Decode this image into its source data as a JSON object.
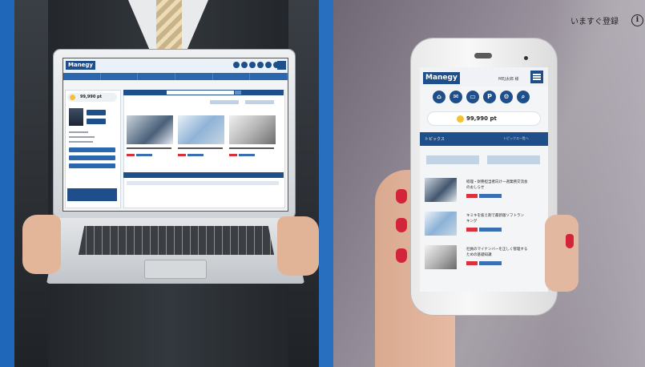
{
  "overlay": {
    "register_label": "いますぐ登録",
    "info_icon": "i"
  },
  "laptop_app": {
    "logo": "Manegy",
    "points": "99,990 pt"
  },
  "phone_app": {
    "logo": "Manegy",
    "user": "MEJ太郎 様",
    "points": "99,990 pt",
    "topics_label": "トピックス",
    "topics_more": "トピックス一覧へ",
    "articles": [
      {
        "title_line1": "経理・財務担当者向け一週業務交流会",
        "title_line2": "のおしらせ"
      },
      {
        "title_line1": "キミキを抜え刺で最新版ソフトラン",
        "title_line2": "キング"
      },
      {
        "title_line1": "社員のマイナンバーを正しく管理する",
        "title_line2": "ための基礎知識"
      }
    ]
  }
}
